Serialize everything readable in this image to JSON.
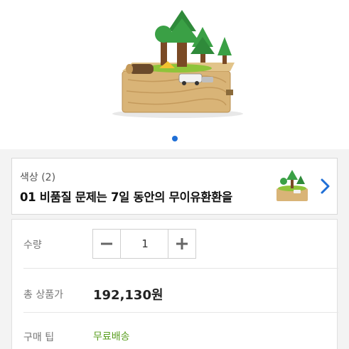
{
  "gallery": {
    "image_alt": "wooden music box with trees",
    "active_dot_color": "#1f6fd6"
  },
  "option": {
    "label": "색상 (2)",
    "value": "01 비품질 문제는 7일 동안의 무이유환환을",
    "chevron_icon": "chevron-right-icon"
  },
  "quantity": {
    "label": "수량",
    "value": "1",
    "minus_icon": "minus-icon",
    "plus_icon": "plus-icon"
  },
  "total": {
    "label": "총 상품가",
    "value": "192,130원"
  },
  "purchase_tip": {
    "label": "구매 팁",
    "value": "무료배송",
    "color": "#5a9e1f"
  }
}
